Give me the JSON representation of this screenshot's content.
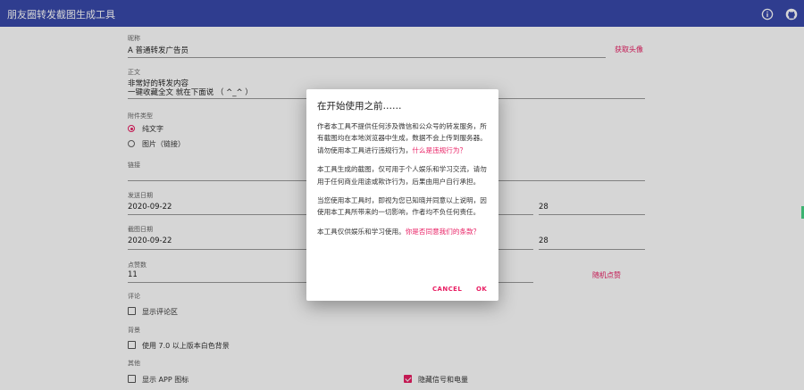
{
  "app": {
    "title": "朋友圈转发截图生成工具",
    "icons": [
      "info-icon",
      "github-icon"
    ]
  },
  "form": {
    "nickname": {
      "label": "昵称",
      "value": "A 普通转发广告员",
      "action": "获取头像"
    },
    "content": {
      "label": "正文",
      "lines": [
        "非常好的转发内容",
        "一键收藏全文 就在下面说 （ ^_^ ）"
      ]
    },
    "attachment": {
      "label": "附件类型",
      "options": [
        {
          "label": "纯文字",
          "selected": true
        },
        {
          "label": "图片（链接）",
          "selected": false
        }
      ]
    },
    "link": {
      "label": "链接",
      "value": ""
    },
    "send_date": {
      "label": "发送日期",
      "value": "2020-09-22",
      "time": "28"
    },
    "shot_date": {
      "label": "截图日期",
      "value": "2020-09-22",
      "time": "28"
    },
    "likes": {
      "label": "点赞数",
      "value": "11",
      "action": "随机点赞"
    },
    "comment": {
      "label": "评论",
      "checkbox": "显示评论区",
      "checked": false
    },
    "background": {
      "label": "背景",
      "checkbox": "使用 7.0 以上版本白色背景",
      "checked": false
    },
    "other": {
      "label": "其他",
      "checkboxes": [
        {
          "label": "显示 APP 图标",
          "checked": false
        },
        {
          "label": "隐藏信号和电量",
          "checked": true
        }
      ]
    }
  },
  "dialog": {
    "title": "在开始使用之前……",
    "p1": "作者本工具不提供任何涉及微信和公众号的转发服务，所有截图均在本地浏览器中生成，数据不会上传到服务器。请勿使用本工具进行违规行为，",
    "p1_link": "什么是违规行为？",
    "p2": "本工具生成的截图，仅可用于个人娱乐和学习交流，请勿用于任何商业用途或欺诈行为，后果由用户自行承担。",
    "p3": "当您使用本工具时，即视为您已知晓并同意以上说明，因使用本工具所带来的一切影响，作者均不负任何责任。",
    "p4": "本工具仅供娱乐和学习使用。",
    "p4_link": "你是否同意我们的条款？",
    "cancel": "CANCEL",
    "ok": "OK"
  },
  "colors": {
    "primary": "#3949ab",
    "accent": "#e91e63"
  }
}
